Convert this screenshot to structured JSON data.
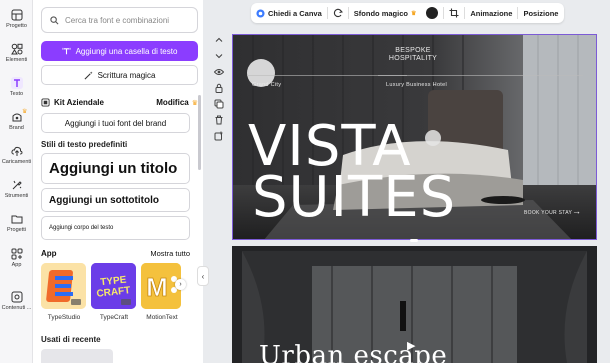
{
  "rail": {
    "items": [
      {
        "label": "Progetto",
        "icon": "layout-icon"
      },
      {
        "label": "Elementi",
        "icon": "shapes-icon"
      },
      {
        "label": "Testo",
        "icon": "text-icon"
      },
      {
        "label": "Brand",
        "icon": "brand-icon"
      },
      {
        "label": "Caricamenti",
        "icon": "cloud-upload-icon"
      },
      {
        "label": "Strumenti",
        "icon": "tools-icon"
      },
      {
        "label": "Progetti",
        "icon": "folder-icon"
      },
      {
        "label": "App",
        "icon": "apps-icon"
      },
      {
        "label": "Contenuti ...",
        "icon": "content-icon"
      }
    ],
    "active": "Testo"
  },
  "panel": {
    "search_placeholder": "Cerca tra font e combinazioni",
    "add_textbox_label": "Aggiungi una casella di testo",
    "magic_write_label": "Scrittura magica",
    "kit_label": "Kit Aziendale",
    "kit_edit_label": "Modifica",
    "add_brand_fonts_label": "Aggiungi i tuoi font del brand",
    "default_styles_title": "Stili di testo predefiniti",
    "heading_label": "Aggiungi un titolo",
    "subheading_label": "Aggiungi un sottotitolo",
    "body_label": "Aggiungi corpo del testo",
    "apps_title": "App",
    "show_all_label": "Mostra tutto",
    "apps": [
      {
        "name": "TypeStudio"
      },
      {
        "name": "TypeCraft",
        "tile_text": "TYPE CRAFT"
      },
      {
        "name": "MotionText",
        "tile_text": "M"
      }
    ],
    "recent_title": "Usati di recente"
  },
  "toolbar": {
    "ask_canva": "Chiedi a Canva",
    "magic_bg": "Sfondo magico",
    "animation": "Animazione",
    "position": "Posizione",
    "color_swatch": "#222222"
  },
  "canvas": {
    "page1": {
      "tagline_top": "BESPOKE",
      "tagline_bottom": "HOSPITALITY",
      "city": "Grand City",
      "hotel_type": "Luxury Business Hotel",
      "title_line1": "VISTA",
      "title_line2": "SUITES",
      "cta": "BOOK YOUR STAY"
    },
    "page2": {
      "title": "Urban escape"
    }
  },
  "colors": {
    "accent": "#8b3dff",
    "selection": "#7c5bd6"
  }
}
